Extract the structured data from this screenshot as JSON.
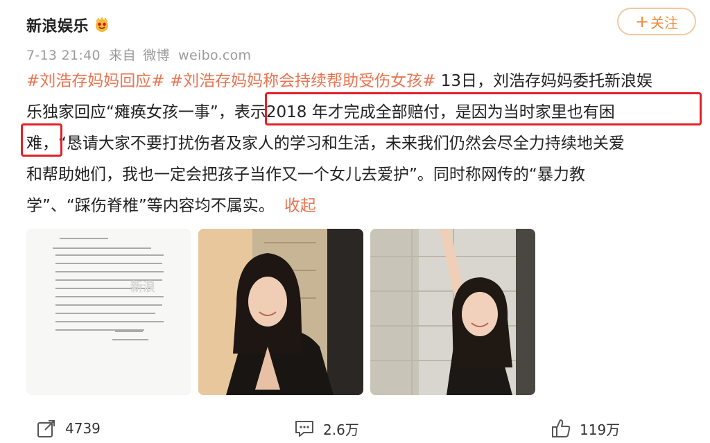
{
  "header": {
    "account_name": "新浪娱乐",
    "follow_label": "关注",
    "follow_prefix": "+"
  },
  "meta": {
    "time": "7-13 21:40",
    "source_prefix": "来自",
    "source_app": "微博",
    "domain": "weibo.com"
  },
  "post": {
    "tag1": "#刘浩存妈妈回应#",
    "tag2": "#刘浩存妈妈称会持续帮助受伤女孩#",
    "line1_rest": " 13日，刘浩存妈妈委托新浪娱",
    "line2_a": "乐独家回应“瘫痪女孩一事”",
    "line2_b": "，",
    "line2_c": "表示2018 年才完成全部赔付，是因为当时家里也有困",
    "line3_a": "难，",
    "line3_b": "“恳请大家不要打扰伤者及家人的学习和生活，未来我们仍然会尽全力持续地关爱",
    "line4": "和帮助她们，我也一定会把孩子当作又一个女儿去爱护”。同时称网传的“暴力教",
    "line5_a": "学”、“踩伤脊椎”等内容均不属实。",
    "collapse_label": "收起"
  },
  "images": [
    {
      "name": "document-letter-image"
    },
    {
      "name": "portrait-photo-1"
    },
    {
      "name": "portrait-photo-2"
    }
  ],
  "actions": {
    "share_count": "4739",
    "comment_count": "2.6万",
    "like_count": "119万"
  },
  "colors": {
    "accent": "#eb7350",
    "highlight": "#e5202a",
    "muted": "#9a9a9a"
  }
}
